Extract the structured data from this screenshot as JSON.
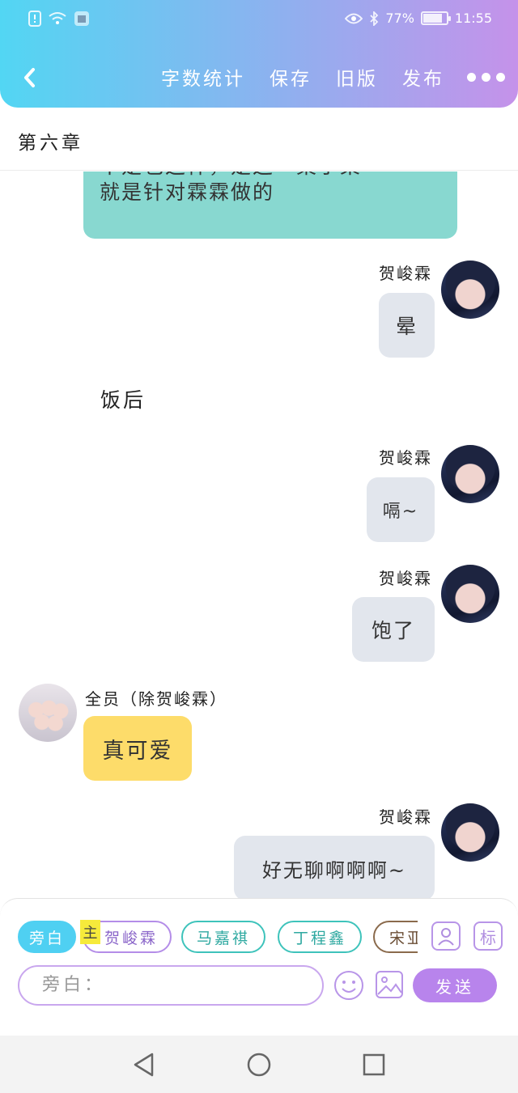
{
  "status_bar": {
    "battery": "77%",
    "time": "11:55",
    "battery_level": 0.77
  },
  "nav": {
    "word_count": "字数统计",
    "save": "保存",
    "old_version": "旧版",
    "publish": "发布"
  },
  "chapter": {
    "title": "第六章"
  },
  "messages": [
    {
      "type": "narration-bubble",
      "text_line1": "不是也这样，是这一桌子菜",
      "text_line2": "就是针对霖霖做的"
    },
    {
      "type": "right",
      "speaker": "贺峻霖",
      "text": "晕"
    },
    {
      "type": "narration",
      "text": "饭后"
    },
    {
      "type": "right",
      "speaker": "贺峻霖",
      "text": "嗝~"
    },
    {
      "type": "right",
      "speaker": "贺峻霖",
      "text": "饱了"
    },
    {
      "type": "left",
      "speaker": "全员（除贺峻霖）",
      "text": "真可爱"
    },
    {
      "type": "right",
      "speaker": "贺峻霖",
      "text": "好无聊啊啊啊~"
    }
  ],
  "composer": {
    "roles": [
      "旁白",
      "贺峻霖",
      "马嘉祺",
      "丁程鑫",
      "宋亚"
    ],
    "main_badge": "主",
    "tag_icon": "标",
    "placeholder": "旁白：",
    "send": "发送"
  },
  "colors": {
    "header_start": "#52d6f3",
    "header_end": "#c592ea",
    "teal_bubble": "#88d8d0",
    "gray_bubble": "#e2e6ed",
    "yellow_bubble": "#fddc6a",
    "send": "#b884ec"
  }
}
